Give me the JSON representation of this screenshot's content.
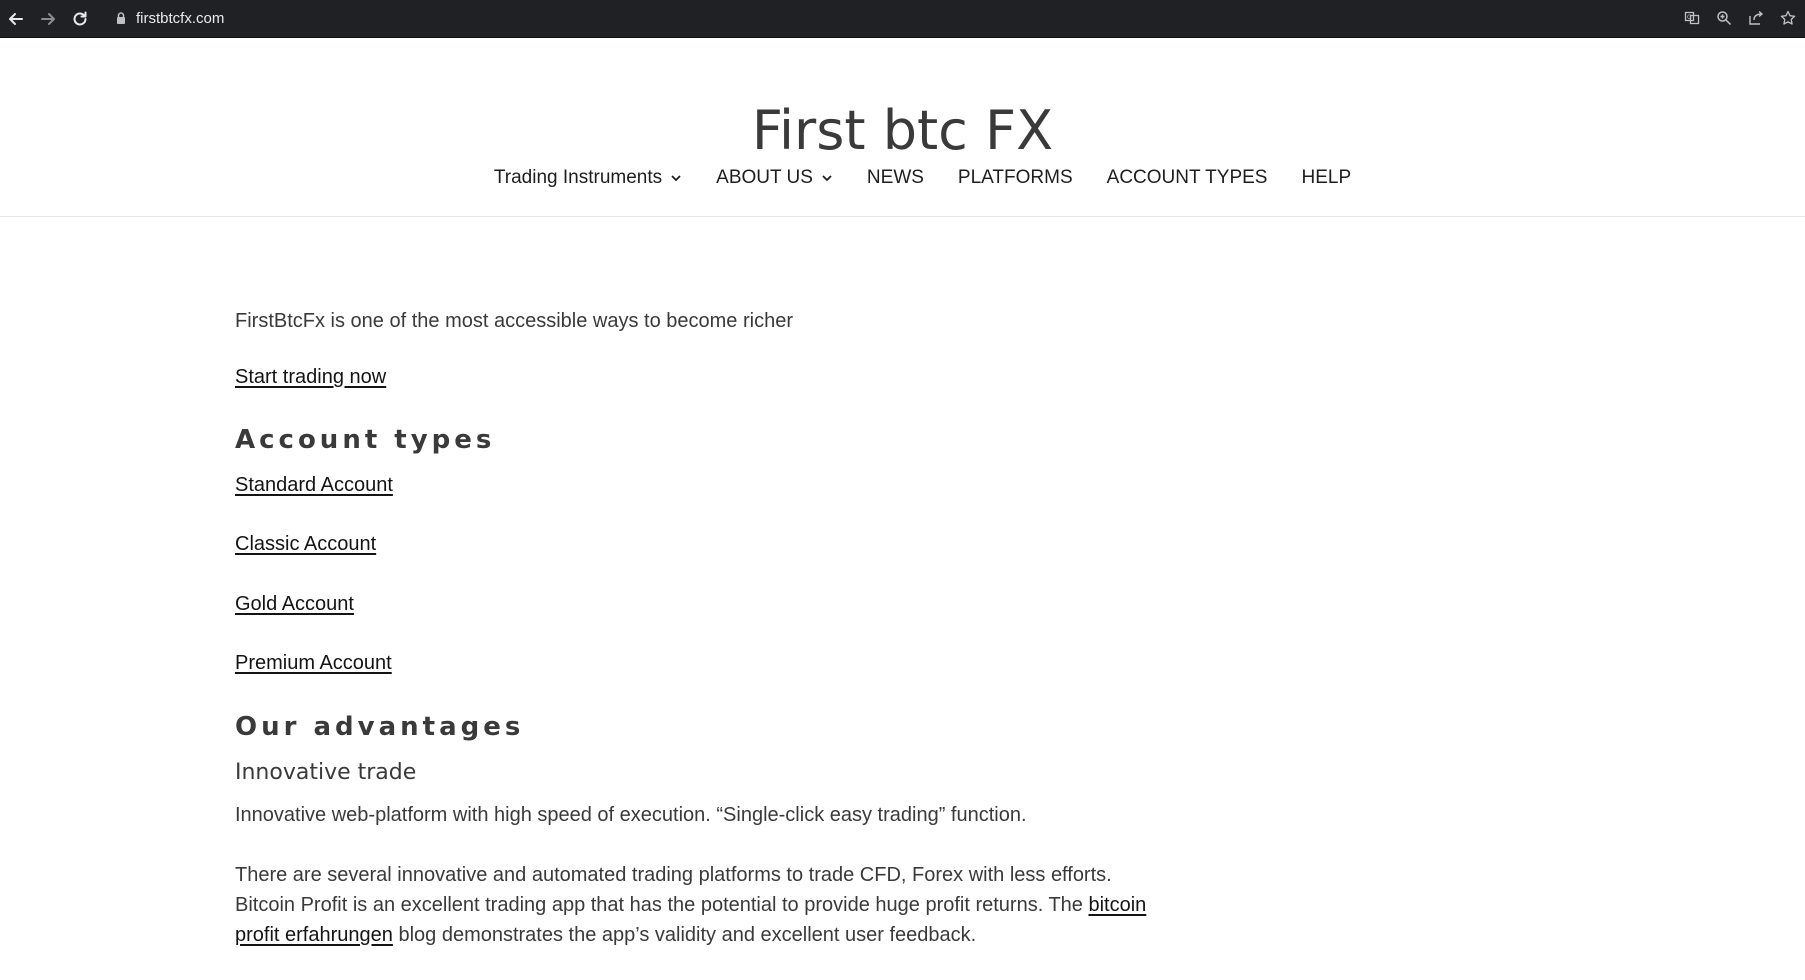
{
  "browser": {
    "url": "firstbtcfx.com",
    "back_icon": "arrow-left-icon",
    "forward_icon": "arrow-right-icon",
    "reload_icon": "reload-icon",
    "actions": [
      "translate-icon",
      "zoom-icon",
      "share-icon",
      "star-icon"
    ]
  },
  "header": {
    "site_title": "First btc FX",
    "nav": [
      {
        "label": "Trading Instruments",
        "dropdown": true
      },
      {
        "label": "ABOUT US",
        "dropdown": true
      },
      {
        "label": "NEWS",
        "dropdown": false
      },
      {
        "label": "PLATFORMS",
        "dropdown": false
      },
      {
        "label": "ACCOUNT TYPES",
        "dropdown": false
      },
      {
        "label": "HELP",
        "dropdown": false
      }
    ]
  },
  "main": {
    "intro": "FirstBtcFx is one of the most accessible ways to become richer",
    "cta_link": "Start trading now",
    "account_types_title": "Account types",
    "account_links": [
      "Standard Account",
      "Classic Account",
      "Gold Account",
      "Premium Account"
    ],
    "advantages_title": "Our advantages",
    "innovative_title": "Innovative trade",
    "innovative_text": "Innovative web-platform with high speed of execution. “Single-click easy trading” function.",
    "para_part1": "There are several innovative and automated trading platforms to trade CFD, Forex with less efforts. Bitcoin Profit is an excellent trading app that has the potential to provide huge profit returns. The ",
    "para_link": "bitcoin profit erfahrungen",
    "para_part2": " blog demonstrates the app’s validity and excellent user feedback."
  },
  "colors": {
    "chrome_bg": "#202124",
    "text": "#3a3a3a",
    "link": "#141414"
  }
}
